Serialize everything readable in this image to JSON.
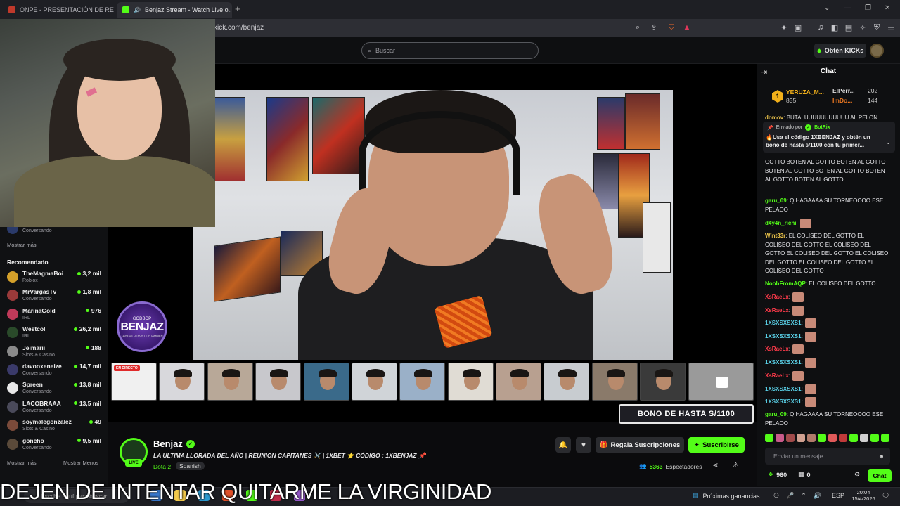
{
  "browser": {
    "tabs": [
      {
        "label": "ONPE - PRESENTACIÓN DE RESULTA...",
        "active": false
      },
      {
        "label": "Benjaz Stream - Watch Live o...",
        "active": true
      }
    ],
    "url": "kick.com/benjaz"
  },
  "header": {
    "search_placeholder": "Buscar",
    "kicks_label": "Obtén KICKs"
  },
  "sidebar": {
    "partial_item": {
      "name": "",
      "category": "Conversando"
    },
    "show_more_1": "Mostrar más",
    "recommended_title": "Recomendado",
    "recommended": [
      {
        "name": "TheMagmaBoi",
        "category": "Roblox",
        "viewers": "3,2 mil",
        "color": "#d4a02a"
      },
      {
        "name": "MrVargasTv",
        "category": "Conversando",
        "viewers": "1,8 mil",
        "color": "#9a3a3a"
      },
      {
        "name": "MarinaGold",
        "category": "IRL",
        "viewers": "976",
        "color": "#c03a5a"
      },
      {
        "name": "Westcol",
        "category": "IRL",
        "viewers": "26,2 mil",
        "color": "#2a4a2a"
      },
      {
        "name": "Jeimarii",
        "category": "Slots & Casino",
        "viewers": "188",
        "color": "#8a8a8a"
      },
      {
        "name": "davooxeneize",
        "category": "Conversando",
        "viewers": "14,7 mil",
        "color": "#3a3a6a"
      },
      {
        "name": "Spreen",
        "category": "Conversando",
        "viewers": "13,8 mil",
        "color": "#e8e8e8"
      },
      {
        "name": "LACOBRAAA",
        "category": "Conversando",
        "viewers": "13,5 mil",
        "color": "#4a4a5a"
      },
      {
        "name": "soymalegonzalez",
        "category": "Slots & Casino",
        "viewers": "49",
        "color": "#7a4a3a"
      },
      {
        "name": "goncho",
        "category": "Conversando",
        "viewers": "9,5 mil",
        "color": "#5a4a3a"
      }
    ],
    "show_more_2": "Mostrar más",
    "show_less": "Mostrar Menos"
  },
  "video": {
    "team_badge": {
      "top": "GODBOP",
      "name": "BENJAZ",
      "bottom": "110% DE DEPORTE Y TAMBIÉN"
    },
    "thumb_live_label": "EN DIRECTO",
    "bono_banner": "BONO DE HASTA S/1100"
  },
  "stream": {
    "channel": "Benjaz",
    "live": "LIVE",
    "title": "LA ULTIMA LLORADA DEL AÑO | REUNION CAPITANES ⚔️ | 1XBET ⭐ CÓDIGO : 1XBENJAZ 📌",
    "category": "Dota 2",
    "language": "Spanish",
    "gift_label": "Regala Suscripciones",
    "subscribe_label": "Suscribirse",
    "viewers": "5363",
    "viewers_label": "Espectadores"
  },
  "chat": {
    "title": "Chat",
    "leaders": [
      {
        "rank": "1",
        "name": "YERUZA_M...",
        "count": "835"
      },
      {
        "name": "ElPerr...",
        "count": "202"
      },
      {
        "name": "ImDo...",
        "count": "144"
      }
    ],
    "cutoff_line": "BUTALUUUUUUUUUUU AL PELON",
    "cutoff_user": "domov",
    "pinned_sender_label": "Enviado por",
    "pinned_sender": "BotRix",
    "pinned_text": "🔥Usa el código 1XBENJAZ y obtén un bono de hasta s/1100 con tu primer...",
    "messages": [
      {
        "user": "",
        "text": "GOTTO BOTEN AL GOTTO BOTEN AL GOTTO BOTEN AL GOTTO BOTEN AL GOTTO BOTEN AL GOTTO BOTEN AL GOTTO",
        "color": "#e6e6ea"
      },
      {
        "user": "garu_09",
        "text": "Q HAGAAAA SU TORNEOOOO ESE PELAOO",
        "color": "#53fc18"
      },
      {
        "user": "d4y4n_richi",
        "text": "",
        "color": "#53fc18"
      },
      {
        "user": "Wint33r",
        "text": "EL COLISEO DEL GOTTO EL COLISEO DEL GOTTO EL COLISEO DEL GOTTO EL COLISEO DEL GOTTO EL COLISEO DEL GOTTO EL COLISEO DEL GOTTO EL COLISEO DEL GOTTO",
        "color": "#f2c94c"
      },
      {
        "user": "NoobFromAQP",
        "text": "EL COLISEO DEL GOTTO",
        "color": "#53fc18"
      },
      {
        "user": "XsRaeLx",
        "text": "",
        "color": "#ff3a4a"
      },
      {
        "user": "XsRaeLx",
        "text": "",
        "color": "#ff3a4a"
      },
      {
        "user": "1XSXSXSXS1",
        "text": "",
        "color": "#5ad1e8"
      },
      {
        "user": "1XSXSXSXS1",
        "text": "",
        "color": "#5ad1e8"
      },
      {
        "user": "XsRaeLx",
        "text": "",
        "color": "#ff3a4a"
      },
      {
        "user": "1XSXSXSXS1",
        "text": "",
        "color": "#5ad1e8"
      },
      {
        "user": "XsRaeLx",
        "text": "",
        "color": "#ff3a4a"
      },
      {
        "user": "1XSXSXSXS1",
        "text": "",
        "color": "#5ad1e8"
      },
      {
        "user": "1XSXSXSXS1",
        "text": "",
        "color": "#5ad1e8"
      },
      {
        "user": "garu_09",
        "text": "Q HAGAAAA SU TORNEOOOO ESE PELAOO",
        "color": "#53fc18"
      }
    ],
    "input_placeholder": "Enviar un mensaje",
    "points": "960",
    "gifts": "0",
    "send_label": "Chat"
  },
  "overlay_subtitle": "DEJEN DE INTENTAR QUITARME LA VIRGINIDAD",
  "taskbar": {
    "search_placeholder": "Escribe aquí para buscar",
    "news": "Próximas ganancias",
    "lang": "ESP",
    "time": "20:04",
    "date": "15/4/2026"
  }
}
